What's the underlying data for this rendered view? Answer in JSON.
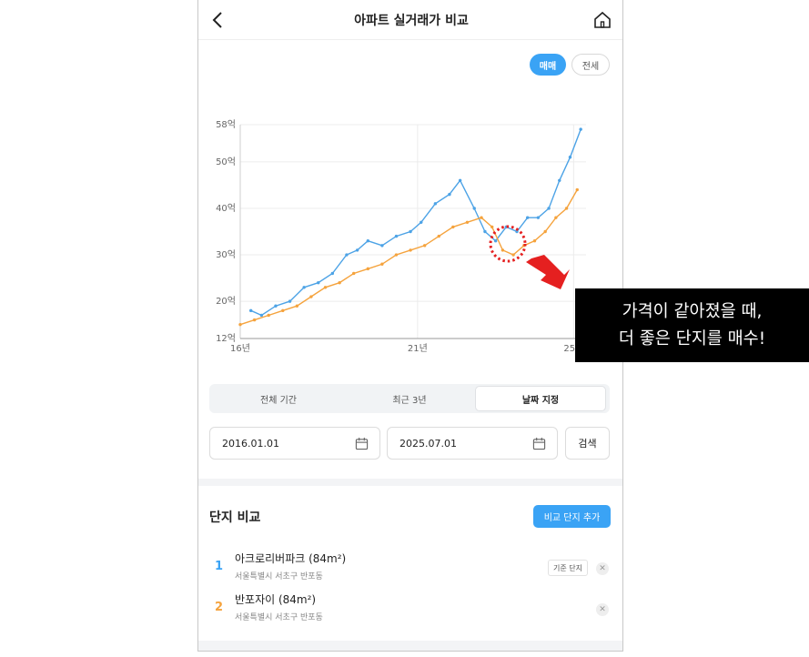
{
  "header": {
    "title": "아파트 실거래가 비교"
  },
  "trade_type": {
    "sale": "매매",
    "jeonse": "전세",
    "selected": "매매"
  },
  "chart_data": {
    "type": "line",
    "x_ticks": [
      "16년",
      "21년",
      "25년"
    ],
    "y_ticks": [
      "58억",
      "50억",
      "40억",
      "30억",
      "20억",
      "12억"
    ],
    "ylim": [
      12,
      58
    ],
    "grid": true,
    "series": [
      {
        "color": "#4da3e6",
        "x": [
          2016.3,
          2016.6,
          2017.0,
          2017.4,
          2017.8,
          2018.2,
          2018.6,
          2019.0,
          2019.3,
          2019.6,
          2020.0,
          2020.4,
          2020.8,
          2021.1,
          2021.5,
          2021.9,
          2022.2,
          2022.6,
          2022.9,
          2023.2,
          2023.5,
          2023.8,
          2024.1,
          2024.4,
          2024.7,
          2025.0,
          2025.3,
          2025.6
        ],
        "values": [
          18,
          17,
          19,
          20,
          23,
          24,
          26,
          30,
          31,
          33,
          32,
          34,
          35,
          37,
          41,
          43,
          46,
          40,
          35,
          33,
          36,
          35,
          38,
          38,
          40,
          46,
          51,
          57
        ]
      },
      {
        "color": "#f5a33d",
        "x": [
          2016.0,
          2016.4,
          2016.8,
          2017.2,
          2017.6,
          2018.0,
          2018.4,
          2018.8,
          2019.2,
          2019.6,
          2020.0,
          2020.4,
          2020.8,
          2021.2,
          2021.6,
          2022.0,
          2022.4,
          2022.8,
          2023.1,
          2023.4,
          2023.7,
          2024.0,
          2024.3,
          2024.6,
          2024.9,
          2025.2,
          2025.5
        ],
        "values": [
          15,
          16,
          17,
          18,
          19,
          21,
          23,
          24,
          26,
          27,
          28,
          30,
          31,
          32,
          34,
          36,
          37,
          38,
          36,
          31,
          30,
          32,
          33,
          35,
          38,
          40,
          44
        ]
      }
    ]
  },
  "callout": {
    "line1": "가격이 같아졌을 때,",
    "line2": "더 좋은 단지를 매수!",
    "circle_color": "#e52020",
    "arrow_color": "#e52020"
  },
  "range_tabs": [
    {
      "label": "전체 기간",
      "active": false
    },
    {
      "label": "최근 3년",
      "active": false
    },
    {
      "label": "날짜 지정",
      "active": true
    }
  ],
  "date_range": {
    "start": "2016.01.01",
    "end": "2025.07.01",
    "search_label": "검색"
  },
  "compare": {
    "title": "단지 비교",
    "add_button": "비교 단지 추가",
    "items": [
      {
        "num": "1",
        "name": "아크로리버파크 (84m²)",
        "address": "서울특별시 서초구 반포동",
        "badge": "기준 단지",
        "color": "#3aa3f5"
      },
      {
        "num": "2",
        "name": "반포자이 (84m²)",
        "address": "서울특별시 서초구 반포동",
        "color": "#f5a33d"
      }
    ]
  }
}
